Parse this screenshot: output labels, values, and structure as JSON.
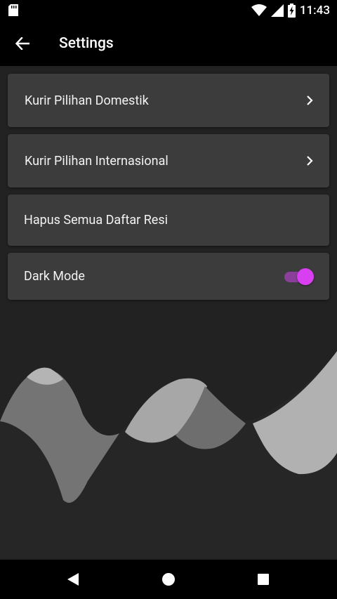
{
  "status_bar": {
    "time": "11:43",
    "icons": [
      "sd-card-icon",
      "wifi-icon",
      "signal-icon",
      "battery-charging-icon"
    ]
  },
  "app_bar": {
    "title": "Settings",
    "back_icon": "arrow-left-icon"
  },
  "settings": {
    "items": [
      {
        "label": "Kurir Pilihan Domestik",
        "icon": "chevron-right-icon"
      },
      {
        "label": "Kurir Pilihan Internasional",
        "icon": "chevron-right-icon"
      },
      {
        "label": "Hapus Semua Daftar Resi"
      },
      {
        "label": "Dark Mode",
        "toggle_on": true
      }
    ]
  },
  "nav_bar": {
    "icons": [
      "back-triangle-icon",
      "home-circle-icon",
      "recents-square-icon"
    ]
  },
  "colors": {
    "background": "#222222",
    "card": "#3c3c3c",
    "accent": "#d83ff0",
    "accent_track": "#8a3f9a"
  }
}
